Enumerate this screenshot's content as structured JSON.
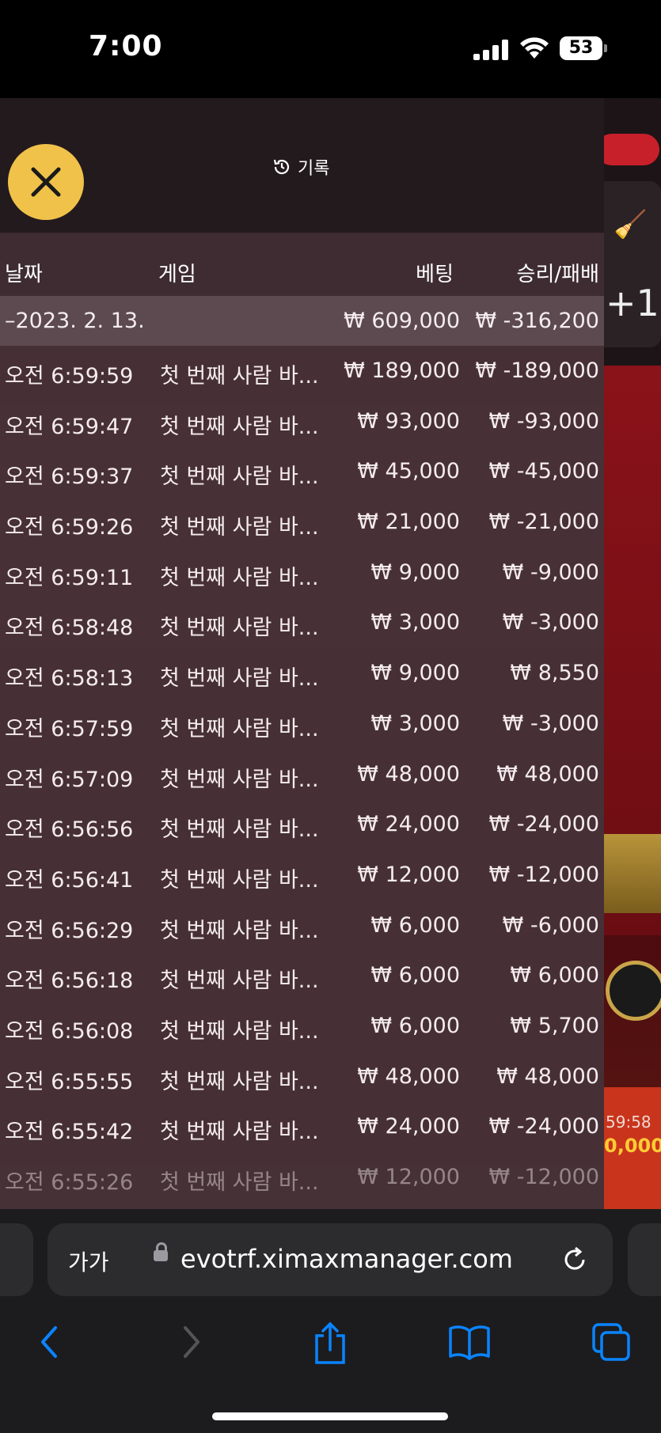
{
  "status_bar": {
    "time": "7:00",
    "battery": "53"
  },
  "panel": {
    "title": "기록",
    "columns": {
      "date": "날짜",
      "game": "게임",
      "bet": "베팅",
      "result": "승리/패배"
    },
    "summary": {
      "date": "–2023. 2. 13.",
      "bet": "₩ 609,000",
      "result": "₩ -316,200"
    },
    "rows": [
      {
        "time": "오전 6:59:59",
        "game": "첫 번째 사람 바...",
        "bet": "₩ 189,000",
        "result": "₩ -189,000"
      },
      {
        "time": "오전 6:59:47",
        "game": "첫 번째 사람 바...",
        "bet": "₩ 93,000",
        "result": "₩ -93,000"
      },
      {
        "time": "오전 6:59:37",
        "game": "첫 번째 사람 바...",
        "bet": "₩ 45,000",
        "result": "₩ -45,000"
      },
      {
        "time": "오전 6:59:26",
        "game": "첫 번째 사람 바...",
        "bet": "₩ 21,000",
        "result": "₩ -21,000"
      },
      {
        "time": "오전 6:59:11",
        "game": "첫 번째 사람 바...",
        "bet": "₩ 9,000",
        "result": "₩ -9,000"
      },
      {
        "time": "오전 6:58:48",
        "game": "첫 번째 사람 바...",
        "bet": "₩ 3,000",
        "result": "₩ -3,000"
      },
      {
        "time": "오전 6:58:13",
        "game": "첫 번째 사람 바...",
        "bet": "₩ 9,000",
        "result": "₩ 8,550"
      },
      {
        "time": "오전 6:57:59",
        "game": "첫 번째 사람 바...",
        "bet": "₩ 3,000",
        "result": "₩ -3,000"
      },
      {
        "time": "오전 6:57:09",
        "game": "첫 번째 사람 바...",
        "bet": "₩ 48,000",
        "result": "₩ 48,000"
      },
      {
        "time": "오전 6:56:56",
        "game": "첫 번째 사람 바...",
        "bet": "₩ 24,000",
        "result": "₩ -24,000"
      },
      {
        "time": "오전 6:56:41",
        "game": "첫 번째 사람 바...",
        "bet": "₩ 12,000",
        "result": "₩ -12,000"
      },
      {
        "time": "오전 6:56:29",
        "game": "첫 번째 사람 바...",
        "bet": "₩ 6,000",
        "result": "₩ -6,000"
      },
      {
        "time": "오전 6:56:18",
        "game": "첫 번째 사람 바...",
        "bet": "₩ 6,000",
        "result": "₩ 6,000"
      },
      {
        "time": "오전 6:56:08",
        "game": "첫 번째 사람 바...",
        "bet": "₩ 6,000",
        "result": "₩ 5,700"
      },
      {
        "time": "오전 6:55:55",
        "game": "첫 번째 사람 바...",
        "bet": "₩ 48,000",
        "result": "₩ 48,000"
      },
      {
        "time": "오전 6:55:42",
        "game": "첫 번째 사람 바...",
        "bet": "₩ 24,000",
        "result": "₩ -24,000"
      },
      {
        "time": "오전 6:55:26",
        "game": "첫 번째 사람 바...",
        "bet": "₩ 12,000",
        "result": "₩ -12,000"
      }
    ]
  },
  "game_peek": {
    "plus": "+1",
    "clock": "59:58",
    "amount": "0,000"
  },
  "browser": {
    "text_size": "가가",
    "url": "evotrf.ximaxmanager.com"
  },
  "colors": {
    "close_button": "#f0c24a",
    "accent_blue": "#0a84ff"
  }
}
